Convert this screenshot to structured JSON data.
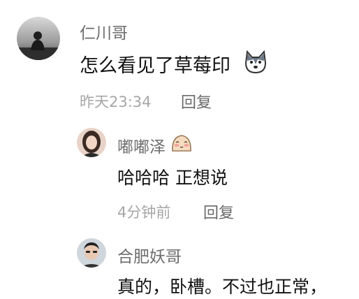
{
  "comments": [
    {
      "user": "仁川哥",
      "text": "怎么看见了草莓印",
      "emoji": "husky-dog-emoji",
      "time": "昨天23:34",
      "reply_label": "回复"
    },
    {
      "user": "嘟嘟泽",
      "user_emoji": "blush-face-emoji",
      "text": "哈哈哈 正想说",
      "time": "4分钟前",
      "reply_label": "回复"
    },
    {
      "user": "合肥妖哥",
      "text": "真的，卧槽。不过也正常，"
    }
  ]
}
